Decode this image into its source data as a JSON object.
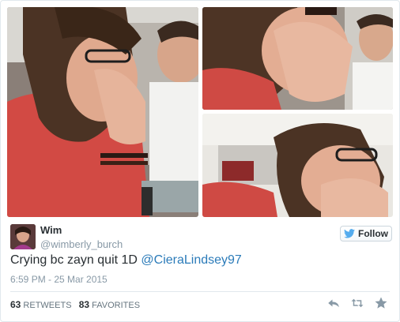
{
  "user": {
    "name": "Wim",
    "handle": "@wimberly_burch"
  },
  "follow": {
    "label": "Follow"
  },
  "tweet": {
    "text": "Crying bc zayn quit 1D ",
    "mention": "@CieraLindsey97",
    "timestamp": "6:59 PM - 25 Mar 2015"
  },
  "stats": {
    "retweets_count": "63",
    "retweets_label": "RETWEETS",
    "favorites_count": "83",
    "favorites_label": "FAVORITES"
  },
  "icons": {
    "follow": "twitter-bird-icon",
    "reply": "reply-icon",
    "retweet": "retweet-icon",
    "favorite": "star-icon"
  },
  "colors": {
    "link": "#2b7bb9",
    "muted": "#8899a6",
    "text": "#292f33"
  }
}
